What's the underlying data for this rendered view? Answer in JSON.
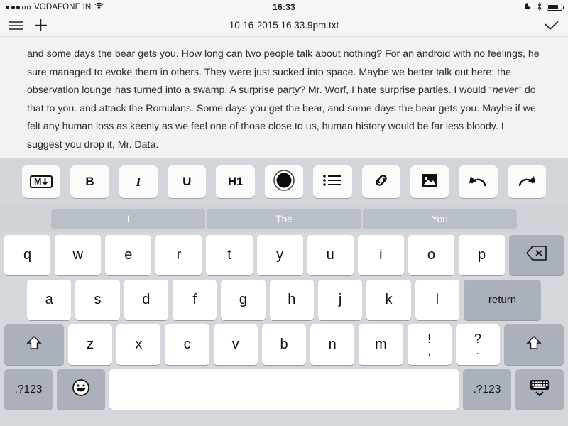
{
  "status_bar": {
    "carrier": "VODAFONE IN",
    "signal_dots_filled": 3,
    "signal_dots_empty": 2,
    "wifi_icon": "wifi-icon",
    "time": "16:33",
    "do_not_disturb_icon": "moon-icon",
    "bluetooth_icon": "bluetooth-icon",
    "battery_icon": "battery-icon",
    "battery_level_pct": 78
  },
  "nav_bar": {
    "menu_icon": "hamburger-menu-icon",
    "add_icon": "plus-icon",
    "title": "10-16-2015 16.33.9pm.txt",
    "done_icon": "checkmark-icon"
  },
  "editor": {
    "text_before_emphasis": "and some days the bear gets you. How long can two people talk about nothing? For an android with no feelings, he sure managed to evoke them in others. They were just sucked into space. Maybe we better talk out here; the observation lounge has turned into a swamp. A surprise party? Mr. Worf, I hate surprise parties. I would ",
    "emphasis_open_mark": "*",
    "emphasis_text": "never",
    "emphasis_close_mark": "*",
    "text_after_emphasis": " do that to you. and attack the Romulans. Some days you get the bear, and some days the bear gets you. Maybe if we felt any human loss as keenly as we feel one of those close to us, human history would be far less bloody. I suggest you drop it, Mr. Data."
  },
  "format_toolbar": {
    "buttons": [
      {
        "name": "markdown-button",
        "label": "M",
        "icon": "markdown-icon"
      },
      {
        "name": "bold-button",
        "label": "B",
        "icon": "bold-icon"
      },
      {
        "name": "italic-button",
        "label": "I",
        "icon": "italic-icon"
      },
      {
        "name": "underline-button",
        "label": "U",
        "icon": "underline-icon"
      },
      {
        "name": "heading1-button",
        "label": "H1",
        "icon": "h1-icon"
      },
      {
        "name": "record-button",
        "label": "",
        "icon": "record-icon"
      },
      {
        "name": "bullet-list-button",
        "label": "",
        "icon": "bullet-list-icon"
      },
      {
        "name": "link-button",
        "label": "",
        "icon": "link-icon"
      },
      {
        "name": "image-button",
        "label": "",
        "icon": "image-icon"
      },
      {
        "name": "undo-button",
        "label": "",
        "icon": "undo-icon"
      },
      {
        "name": "redo-button",
        "label": "",
        "icon": "redo-icon"
      }
    ]
  },
  "suggestion_bar": {
    "suggestions": [
      "I",
      "The",
      "You"
    ]
  },
  "keyboard": {
    "row1": [
      "q",
      "w",
      "e",
      "r",
      "t",
      "y",
      "u",
      "i",
      "o",
      "p"
    ],
    "backspace_icon": "backspace-icon",
    "row2": [
      "a",
      "s",
      "d",
      "f",
      "g",
      "h",
      "j",
      "k",
      "l"
    ],
    "return_label": "return",
    "shift_icon": "shift-icon",
    "row3": [
      "z",
      "x",
      "c",
      "v",
      "b",
      "n",
      "m"
    ],
    "punct_key_1": {
      "top": "!",
      "bottom": ","
    },
    "punct_key_2": {
      "top": "?",
      "bottom": "."
    },
    "numeric_label_left": ".?123",
    "emoji_icon": "emoji-smiley-icon",
    "space_label": "",
    "numeric_label_right": ".?123",
    "hide_keyboard_icon": "hide-keyboard-icon"
  },
  "colors": {
    "editor_bg": "#f2f2f2",
    "toolbar_bg": "#d2d5da",
    "keyboard_bg": "#d4d7dc",
    "key_bg": "#ffffff",
    "key_dark_bg": "#aab1ba",
    "suggestion_bg": "#b8bfc7"
  }
}
